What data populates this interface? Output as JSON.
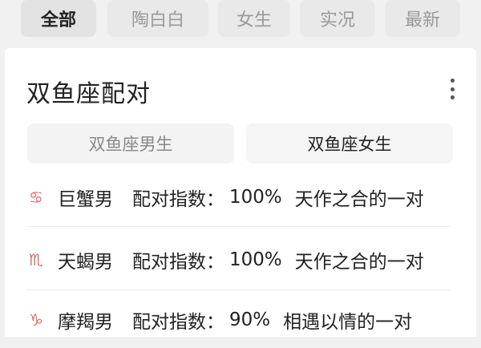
{
  "tabs": [
    {
      "label": "全部",
      "active": true
    },
    {
      "label": "陶白白",
      "active": false
    },
    {
      "label": "女生",
      "active": false
    },
    {
      "label": "实况",
      "active": false
    },
    {
      "label": "最新",
      "active": false
    }
  ],
  "card": {
    "title": "双鱼座配对",
    "more_icon": "more-vertical-icon",
    "segments": {
      "left": "双鱼座男生",
      "right": "双鱼座女生"
    },
    "rows": [
      {
        "icon": "cancer-icon",
        "glyph": "♋",
        "name": "巨蟹男",
        "label": "配对指数：",
        "percent": "100%",
        "desc": "天作之合的一对"
      },
      {
        "icon": "scorpio-icon",
        "glyph": "♏",
        "name": "天蝎男",
        "label": "配对指数：",
        "percent": "100%",
        "desc": "天作之合的一对"
      },
      {
        "icon": "capricorn-icon",
        "glyph": "♑",
        "name": "摩羯男",
        "label": "配对指数：",
        "percent": "90%",
        "desc": "相遇以情的一对"
      }
    ]
  },
  "colors": {
    "accent_icon": "#e06b6b",
    "background": "#f1f1f1"
  }
}
